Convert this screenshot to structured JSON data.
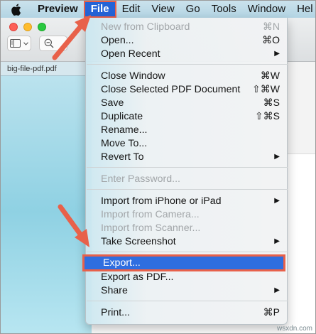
{
  "menubar": {
    "app_name": "Preview",
    "items": [
      "File",
      "Edit",
      "View",
      "Go",
      "Tools",
      "Window",
      "Hel"
    ],
    "active_item": "File"
  },
  "window": {
    "document_tab": "big-file-pdf.pdf",
    "icons": [
      "sidebar-toggle-icon",
      "chevron-down-icon",
      "zoom-out-icon"
    ]
  },
  "file_menu": {
    "groups": [
      [
        {
          "label": "New from Clipboard",
          "shortcut": "⌘N",
          "disabled": true,
          "submenu": false
        },
        {
          "label": "Open...",
          "shortcut": "⌘O",
          "disabled": false,
          "submenu": false
        },
        {
          "label": "Open Recent",
          "shortcut": "",
          "disabled": false,
          "submenu": true
        }
      ],
      [
        {
          "label": "Close Window",
          "shortcut": "⌘W",
          "disabled": false,
          "submenu": false
        },
        {
          "label": "Close Selected PDF Document",
          "shortcut": "⇧⌘W",
          "disabled": false,
          "submenu": false
        },
        {
          "label": "Save",
          "shortcut": "⌘S",
          "disabled": false,
          "submenu": false
        },
        {
          "label": "Duplicate",
          "shortcut": "⇧⌘S",
          "disabled": false,
          "submenu": false
        },
        {
          "label": "Rename...",
          "shortcut": "",
          "disabled": false,
          "submenu": false
        },
        {
          "label": "Move To...",
          "shortcut": "",
          "disabled": false,
          "submenu": false
        },
        {
          "label": "Revert To",
          "shortcut": "",
          "disabled": false,
          "submenu": true
        }
      ],
      [
        {
          "label": "Enter Password...",
          "shortcut": "",
          "disabled": true,
          "submenu": false
        }
      ],
      [
        {
          "label": "Import from iPhone or iPad",
          "shortcut": "",
          "disabled": false,
          "submenu": true
        },
        {
          "label": "Import from Camera...",
          "shortcut": "",
          "disabled": true,
          "submenu": false
        },
        {
          "label": "Import from Scanner...",
          "shortcut": "",
          "disabled": true,
          "submenu": false
        },
        {
          "label": "Take Screenshot",
          "shortcut": "",
          "disabled": false,
          "submenu": true
        }
      ],
      [
        {
          "label": "Export...",
          "shortcut": "",
          "disabled": false,
          "submenu": false,
          "highlighted": true
        },
        {
          "label": "Export as PDF...",
          "shortcut": "",
          "disabled": false,
          "submenu": false
        },
        {
          "label": "Share",
          "shortcut": "",
          "disabled": false,
          "submenu": true
        }
      ],
      [
        {
          "label": "Print...",
          "shortcut": "⌘P",
          "disabled": false,
          "submenu": false
        }
      ]
    ],
    "submenu_glyph": "▶"
  },
  "annotations": {
    "arrow_color": "#e8614a",
    "highlight_color": "#2f6ee0"
  },
  "watermark": "wsxdn.com"
}
